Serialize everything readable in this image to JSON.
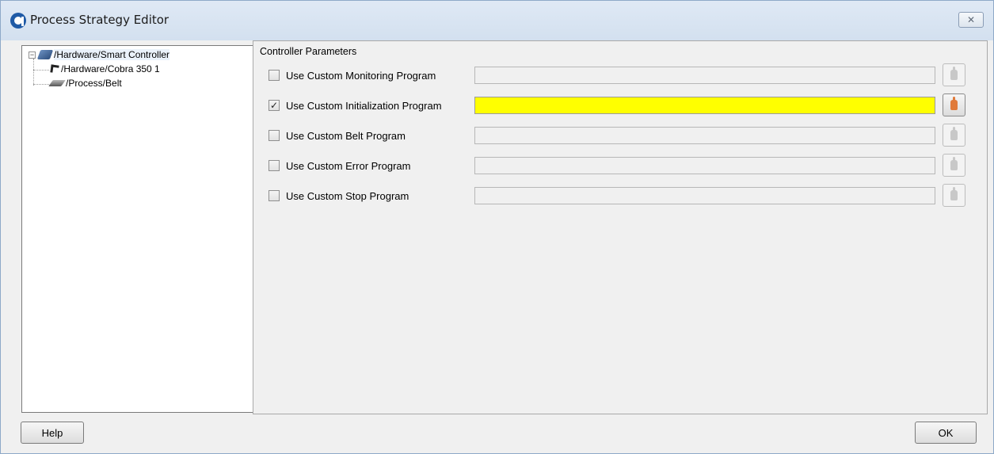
{
  "window": {
    "title": "Process Strategy Editor",
    "close_symbol": "✕"
  },
  "tree": {
    "items": [
      {
        "label": "/Hardware/Smart Controller",
        "icon": "controller-icon",
        "expander": "−",
        "selected": true
      },
      {
        "label": "/Hardware/Cobra 350 1",
        "icon": "robot-icon"
      },
      {
        "label": "/Process/Belt",
        "icon": "belt-icon"
      }
    ]
  },
  "params": {
    "group_title": "Controller Parameters",
    "rows": [
      {
        "label": "Use Custom Monitoring Program",
        "checked": false,
        "value": ""
      },
      {
        "label": "Use Custom Initialization Program",
        "checked": true,
        "check_mark": "✓",
        "value": ""
      },
      {
        "label": "Use Custom Belt Program",
        "checked": false,
        "value": ""
      },
      {
        "label": "Use Custom Error Program",
        "checked": false,
        "value": ""
      },
      {
        "label": "Use Custom Stop Program",
        "checked": false,
        "value": ""
      }
    ]
  },
  "footer": {
    "help_label": "Help",
    "ok_label": "OK"
  },
  "colors": {
    "active_field": "#ffff00",
    "active_pick_icon": "#e07a3a"
  }
}
